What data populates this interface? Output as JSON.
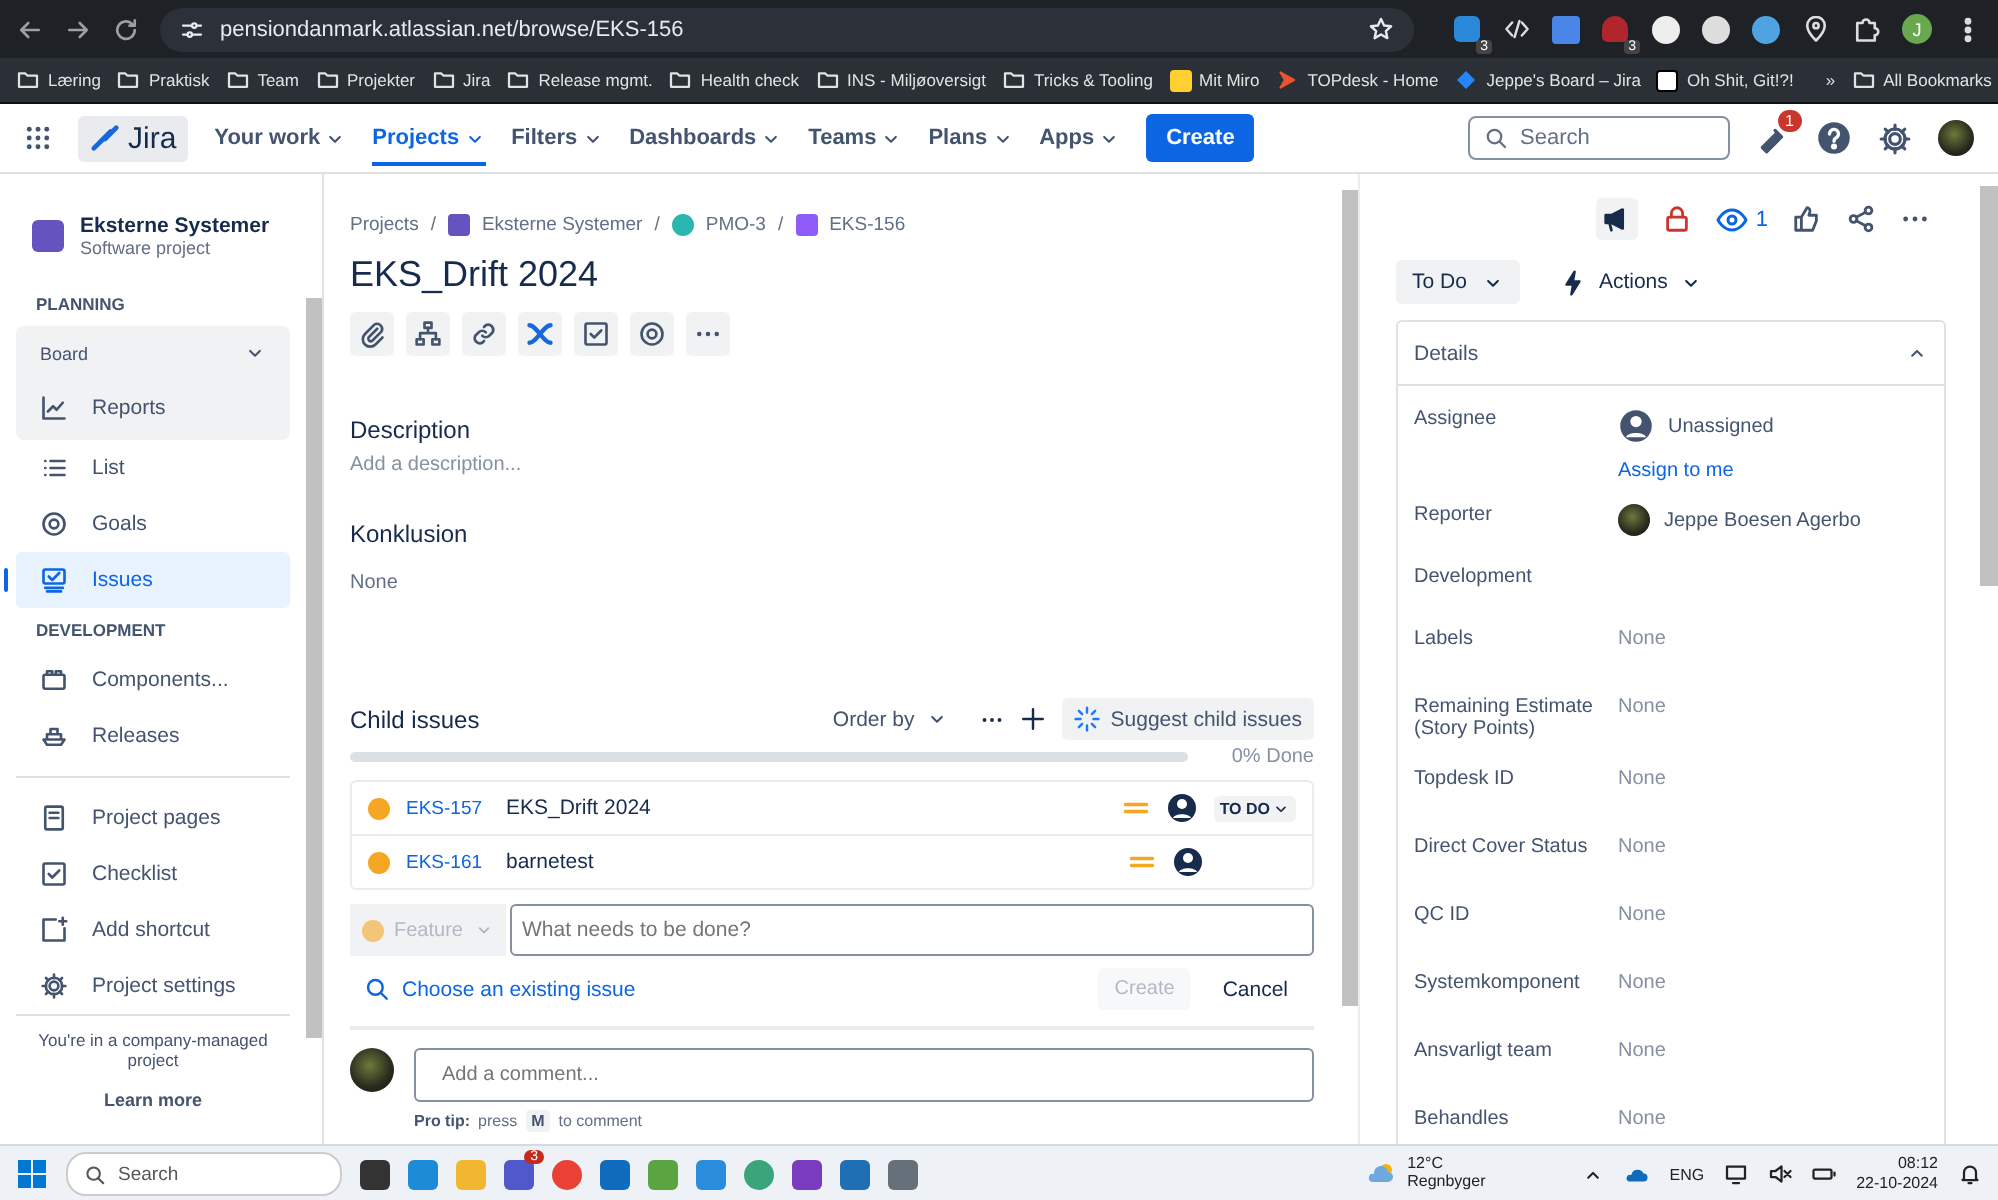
{
  "browser": {
    "url": "pensiondanmark.atlassian.net/browse/EKS-156",
    "extension_badges": [
      "3",
      "3"
    ],
    "profile": "J",
    "bookmarks": [
      {
        "label": "Læring",
        "kind": "folder"
      },
      {
        "label": "Praktisk",
        "kind": "folder"
      },
      {
        "label": "Team",
        "kind": "folder"
      },
      {
        "label": "Projekter",
        "kind": "folder"
      },
      {
        "label": "Jira",
        "kind": "folder"
      },
      {
        "label": "Release mgmt.",
        "kind": "folder"
      },
      {
        "label": "Health check",
        "kind": "folder"
      },
      {
        "label": "INS - Miljøoversigt",
        "kind": "folder"
      },
      {
        "label": "Tricks & Tooling",
        "kind": "folder"
      },
      {
        "label": "Mit Miro",
        "kind": "board"
      },
      {
        "label": "TOPdesk - Home",
        "kind": "arrow"
      },
      {
        "label": "Jeppe's Board – Jira",
        "kind": "diamond"
      },
      {
        "label": "Oh Shit, Git!?!",
        "kind": "page"
      }
    ],
    "overflow": "»",
    "all_bookmarks": "All Bookmarks"
  },
  "nav": {
    "product": "Jira",
    "items": [
      {
        "label": "Your work",
        "selected": false
      },
      {
        "label": "Projects",
        "selected": true
      },
      {
        "label": "Filters",
        "selected": false
      },
      {
        "label": "Dashboards",
        "selected": false
      },
      {
        "label": "Teams",
        "selected": false
      },
      {
        "label": "Plans",
        "selected": false
      },
      {
        "label": "Apps",
        "selected": false
      }
    ],
    "create": "Create",
    "search_placeholder": "Search",
    "notification_count": "1"
  },
  "sidebar": {
    "project_name": "Eksterne Systemer",
    "project_type": "Software project",
    "sections": [
      {
        "heading": "PLANNING",
        "items": [
          {
            "label": "Board",
            "expanded": true,
            "selected": false,
            "children": [
              {
                "label": "Reports",
                "selected": false
              }
            ]
          },
          {
            "label": "List",
            "selected": false
          },
          {
            "label": "Goals",
            "selected": false
          },
          {
            "label": "Issues",
            "selected": true
          }
        ]
      },
      {
        "heading": "DEVELOPMENT",
        "items": [
          {
            "label": "Components...",
            "selected": false
          },
          {
            "label": "Releases",
            "selected": false
          }
        ]
      },
      {
        "items": [
          {
            "label": "Project pages",
            "selected": false
          },
          {
            "label": "Checklist",
            "selected": false
          },
          {
            "label": "Add shortcut",
            "selected": false
          },
          {
            "label": "Project settings",
            "selected": false
          }
        ]
      }
    ],
    "footer_text": "You're in a company-managed project",
    "footer_link": "Learn more"
  },
  "issue": {
    "breadcrumbs": [
      "Projects",
      "Eksterne Systemer",
      "PMO-3",
      "EKS-156"
    ],
    "separator": "/",
    "title": "EKS_Drift 2024",
    "description_heading": "Description",
    "description_placeholder": "Add a description...",
    "conclusion_heading": "Konklusion",
    "conclusion_value": "None",
    "child_issues": {
      "heading": "Child issues",
      "order_by": "Order by",
      "suggest": "Suggest child issues",
      "level": 0,
      "done_label": "0% Done",
      "rows": [
        {
          "key": "EKS-157",
          "summary": "EKS_Drift 2024",
          "status": "TO DO"
        },
        {
          "key": "EKS-161",
          "summary": "barnetest"
        }
      ],
      "type_select": "Feature",
      "input_placeholder": "What needs to be done?",
      "choose_existing": "Choose an existing issue",
      "create": "Create",
      "create_disabled": true,
      "cancel": "Cancel"
    },
    "comment_placeholder": "Add a comment...",
    "pro_tip": {
      "label": "Pro tip:",
      "before": "press",
      "key": "M",
      "after": "to comment"
    }
  },
  "details": {
    "watchers": "1",
    "status": "To Do",
    "actions": "Actions",
    "heading": "Details",
    "expanded": true,
    "fields": [
      {
        "label": "Assignee",
        "kind": "unassigned",
        "value": "Unassigned",
        "action": "Assign to me"
      },
      {
        "label": "Reporter",
        "kind": "user",
        "value": "Jeppe Boesen Agerbo"
      },
      {
        "label": "Development",
        "kind": "empty"
      },
      {
        "label": "Labels",
        "kind": "text",
        "value": "None"
      },
      {
        "label": "Remaining Estimate (Story Points)",
        "kind": "text",
        "value": "None"
      },
      {
        "label": "Topdesk ID",
        "kind": "text",
        "value": "None"
      },
      {
        "label": "Direct Cover Status",
        "kind": "text",
        "value": "None"
      },
      {
        "label": "QC ID",
        "kind": "text",
        "value": "None"
      },
      {
        "label": "Systemkomponent",
        "kind": "text",
        "value": "None"
      },
      {
        "label": "Ansvarligt team",
        "kind": "text",
        "value": "None"
      },
      {
        "label": "Behandles",
        "kind": "text",
        "value": "None"
      }
    ]
  },
  "taskbar": {
    "search_placeholder": "Search",
    "chat_badge": "3",
    "temperature": "12°C",
    "weather": "Regnbyger",
    "language": "ENG",
    "time": "08:12",
    "date": "22-10-2024"
  }
}
